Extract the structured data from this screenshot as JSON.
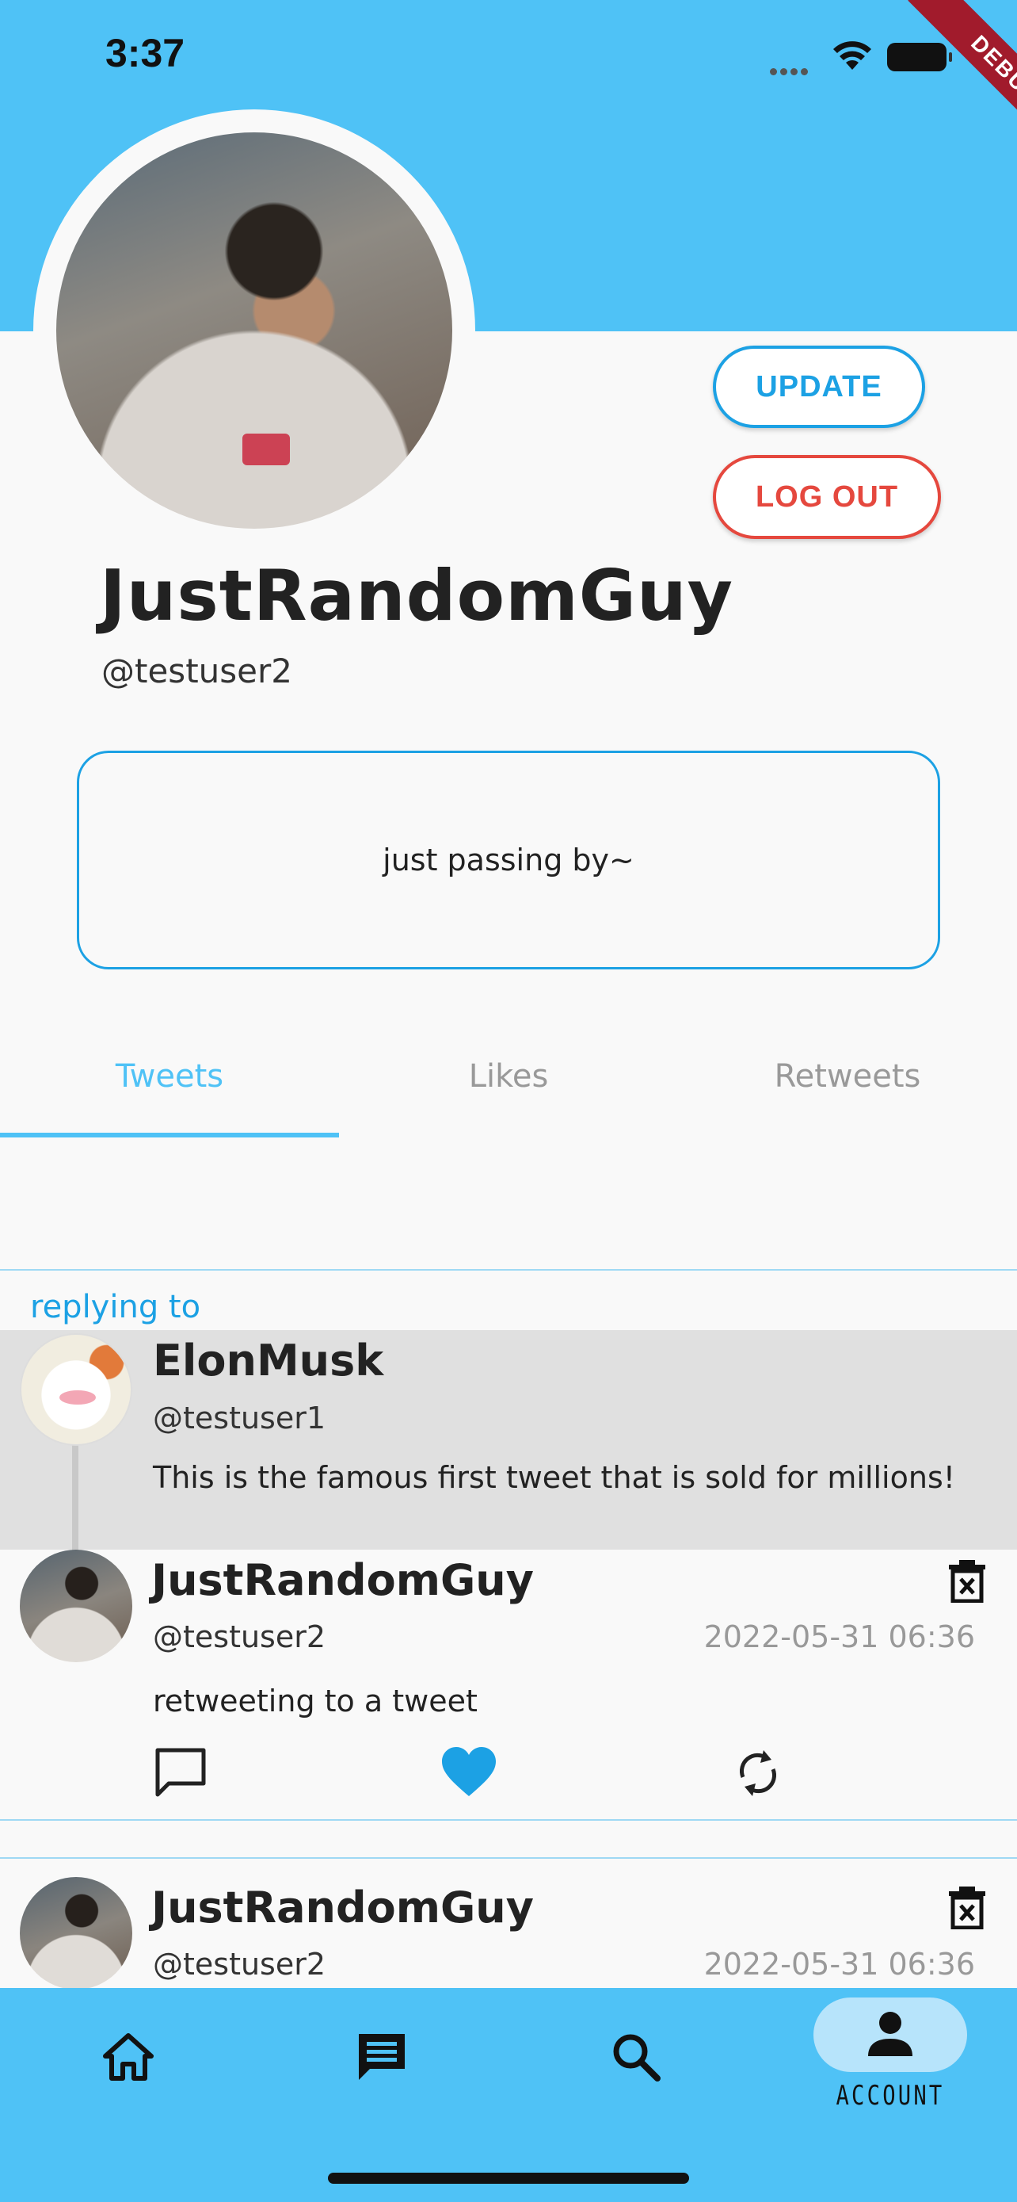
{
  "status_bar": {
    "time": "3:37"
  },
  "debug_banner": "DEBUG",
  "profile": {
    "display_name": "JustRandomGuy",
    "username": "@testuser2",
    "bio": "just passing by~",
    "update_label": "UPDATE",
    "logout_label": "LOG OUT"
  },
  "tabs": [
    {
      "label": "Tweets",
      "active": true
    },
    {
      "label": "Likes",
      "active": false
    },
    {
      "label": "Retweets",
      "active": false
    }
  ],
  "feed": {
    "replying_label": "replying to",
    "quoted": {
      "name": "ElonMusk",
      "handle": "@testuser1",
      "body": "This is the famous first tweet that is sold for millions!"
    },
    "tweets": [
      {
        "name": "JustRandomGuy",
        "handle": "@testuser2",
        "date": "2022-05-31 06:36",
        "body": "retweeting to a tweet",
        "liked": true
      },
      {
        "name": "JustRandomGuy",
        "handle": "@testuser2",
        "date": "2022-05-31 06:36"
      }
    ]
  },
  "bottom_nav": {
    "items": [
      {
        "icon": "home-icon"
      },
      {
        "icon": "messages-icon"
      },
      {
        "icon": "search-icon"
      },
      {
        "icon": "person-icon",
        "label": "ACCOUNT",
        "active": true
      }
    ]
  },
  "colors": {
    "accent": "#4fc2f6",
    "link": "#1ca1e4",
    "danger": "#e5483e",
    "liked": "#1ca1e4"
  }
}
